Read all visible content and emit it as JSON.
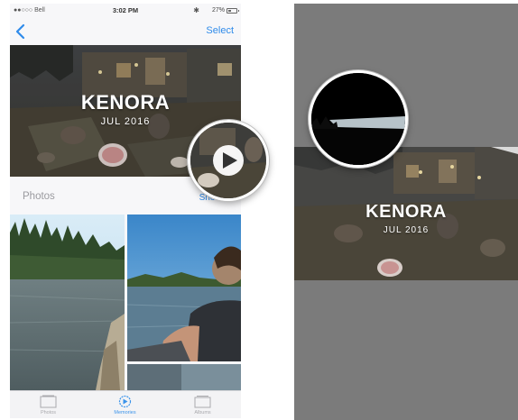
{
  "status_bar": {
    "carrier": "●●○○○ Bell",
    "time": "3:02 PM",
    "battery": "27%"
  },
  "nav": {
    "back_icon": "chevron-left-icon",
    "select_label": "Select"
  },
  "memory": {
    "title": "KENORA",
    "date": "JUL 2016",
    "play_icon": "play-icon"
  },
  "photos_section": {
    "title": "Photos",
    "show_all_label": "Show All"
  },
  "tab_bar": {
    "items": [
      {
        "label": "Photos",
        "icon": "photos-tab-icon"
      },
      {
        "label": "Memories",
        "icon": "memories-tab-icon"
      },
      {
        "label": "Albums",
        "icon": "albums-tab-icon"
      }
    ],
    "active_index": 1
  },
  "colors": {
    "accent": "#2f8bea",
    "right_overlay": "#7b7b7b"
  }
}
